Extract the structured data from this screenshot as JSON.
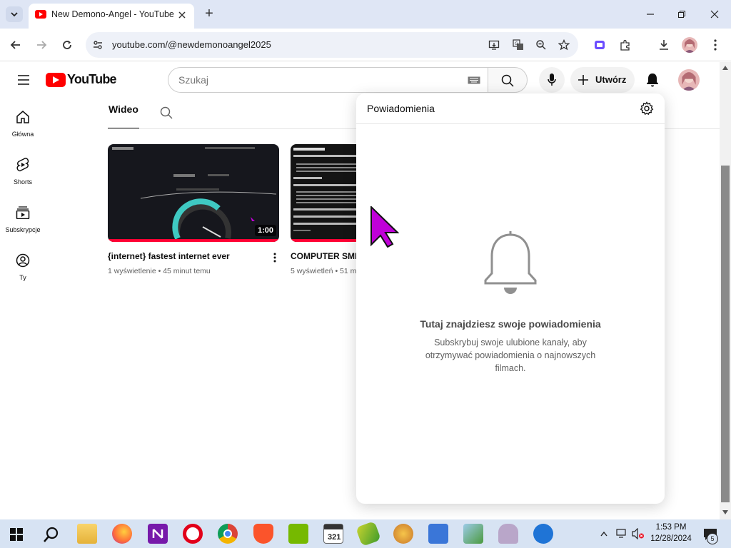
{
  "browser": {
    "tab_title": "New Demono-Angel - YouTube",
    "new_tab_symbol": "+",
    "url": "youtube.com/@newdemonoangel2025",
    "window_controls": [
      "minimize",
      "restore",
      "close"
    ]
  },
  "youtube": {
    "logo_text": "YouTube",
    "search_placeholder": "Szukaj",
    "create_label": "Utwórz",
    "sidebar": [
      {
        "label": "Główna",
        "icon": "home-icon"
      },
      {
        "label": "Shorts",
        "icon": "shorts-icon"
      },
      {
        "label": "Subskrypcje",
        "icon": "subscriptions-icon"
      },
      {
        "label": "Ty",
        "icon": "you-icon"
      }
    ],
    "channel_tabs": {
      "active": "Wideo"
    },
    "videos": [
      {
        "title": "{internet} fastest internet ever",
        "meta": "1 wyświetlenie • 45 minut temu",
        "duration": "1:00"
      },
      {
        "title": "COMPUTER SMB",
        "meta": "5 wyświetleń • 51 m",
        "duration": ""
      }
    ]
  },
  "notifications": {
    "header": "Powiadomienia",
    "empty_title": "Tutaj znajdziesz swoje powiadomienia",
    "empty_text": "Subskrybuj swoje ulubione kanały, aby otrzymywać powiadomienia o najnowszych filmach."
  },
  "taskbar": {
    "time": "1:53 PM",
    "date": "12/28/2024",
    "notification_count": "5"
  },
  "colors": {
    "youtube_red": "#ff0000",
    "tab_bar": "#dfe6f5",
    "taskbar": "#d7e3f3",
    "cursor": "#c000d8"
  }
}
